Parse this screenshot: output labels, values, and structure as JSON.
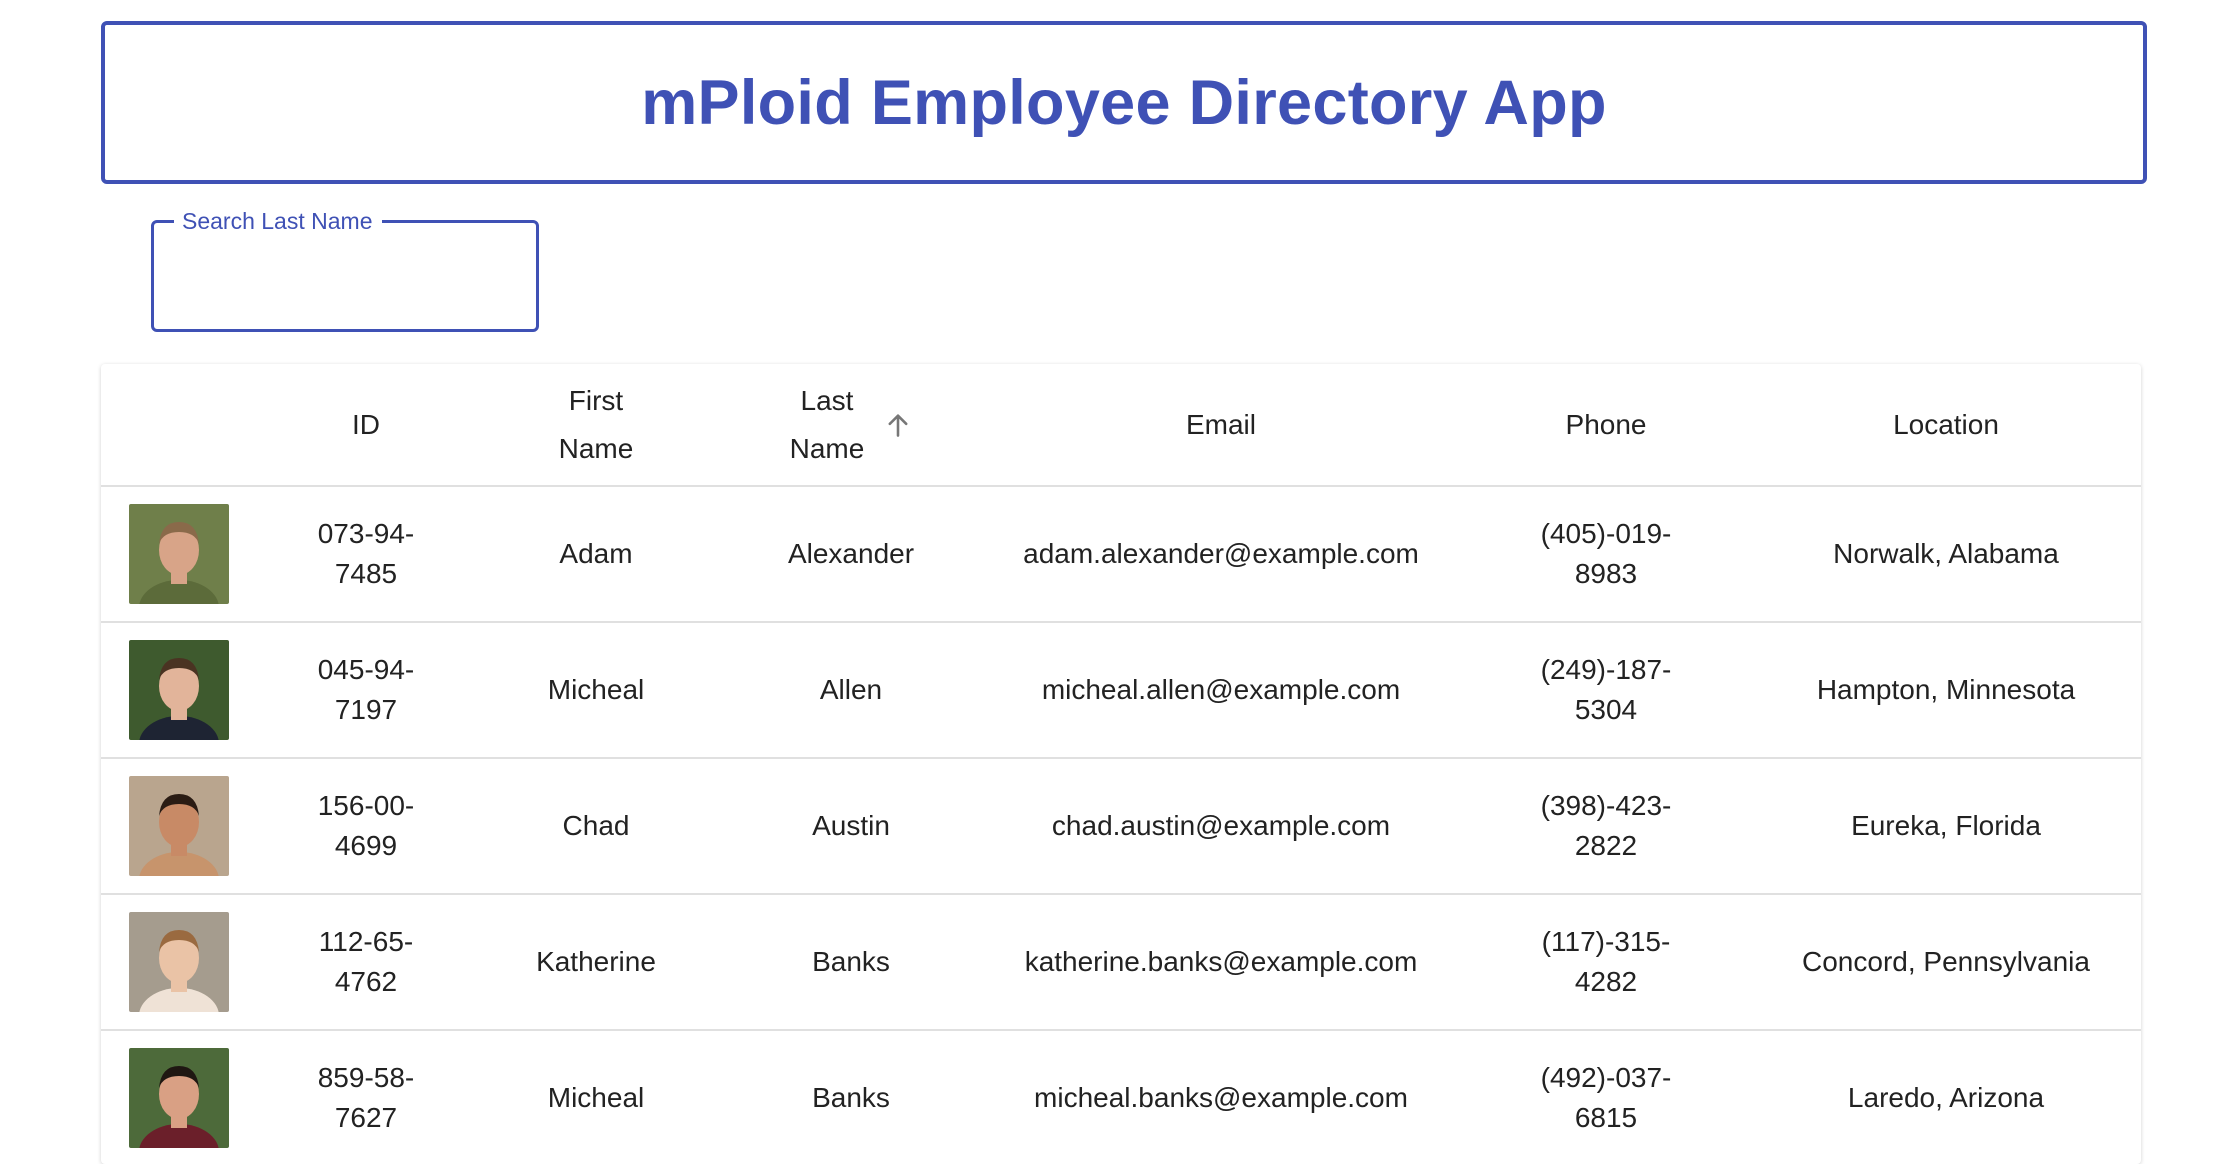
{
  "app": {
    "title": "mPloid Employee Directory App"
  },
  "search": {
    "label": "Search Last Name",
    "value": ""
  },
  "table": {
    "headers": {
      "id": "ID",
      "first_name_1": "First",
      "first_name_2": "Name",
      "last_name_1": "Last",
      "last_name_2": "Name",
      "email": "Email",
      "phone": "Phone",
      "location": "Location"
    },
    "sort": {
      "column": "Last Name",
      "direction": "ascending",
      "icon": "arrow-up-icon"
    },
    "rows": [
      {
        "id_1": "073-94-",
        "id_2": "7485",
        "first": "Adam",
        "last": "Alexander",
        "email": "adam.alexander@example.com",
        "phone_1": "(405)-019-",
        "phone_2": "8983",
        "location": "Norwalk, Alabama",
        "avatar_colors": {
          "bg": "#6f7f4a",
          "skin": "#d8a488",
          "hair": "#8a6a4a",
          "shirt": "#5c6b3a"
        }
      },
      {
        "id_1": "045-94-",
        "id_2": "7197",
        "first": "Micheal",
        "last": "Allen",
        "email": "micheal.allen@example.com",
        "phone_1": "(249)-187-",
        "phone_2": "5304",
        "location": "Hampton, Minnesota",
        "avatar_colors": {
          "bg": "#3e5a2e",
          "skin": "#e2b49a",
          "hair": "#4a3322",
          "shirt": "#1e2433"
        }
      },
      {
        "id_1": "156-00-",
        "id_2": "4699",
        "first": "Chad",
        "last": "Austin",
        "email": "chad.austin@example.com",
        "phone_1": "(398)-423-",
        "phone_2": "2822",
        "location": "Eureka, Florida",
        "avatar_colors": {
          "bg": "#b9a58e",
          "skin": "#c88a66",
          "hair": "#2a1c14",
          "shirt": "#c7946c"
        }
      },
      {
        "id_1": "112-65-",
        "id_2": "4762",
        "first": "Katherine",
        "last": "Banks",
        "email": "katherine.banks@example.com",
        "phone_1": "(117)-315-",
        "phone_2": "4282",
        "location": "Concord, Pennsylvania",
        "avatar_colors": {
          "bg": "#a59c8e",
          "skin": "#eac3a6",
          "hair": "#9a6a40",
          "shirt": "#efe2d6"
        }
      },
      {
        "id_1": "859-58-",
        "id_2": "7627",
        "first": "Micheal",
        "last": "Banks",
        "email": "micheal.banks@example.com",
        "phone_1": "(492)-037-",
        "phone_2": "6815",
        "location": "Laredo, Arizona",
        "avatar_colors": {
          "bg": "#4d6a3a",
          "skin": "#d9a084",
          "hair": "#1f1712",
          "shirt": "#6b1f2a"
        }
      }
    ]
  },
  "colors": {
    "accent": "#3f51b5",
    "divider": "#e0e0e0",
    "text": "#222222"
  }
}
